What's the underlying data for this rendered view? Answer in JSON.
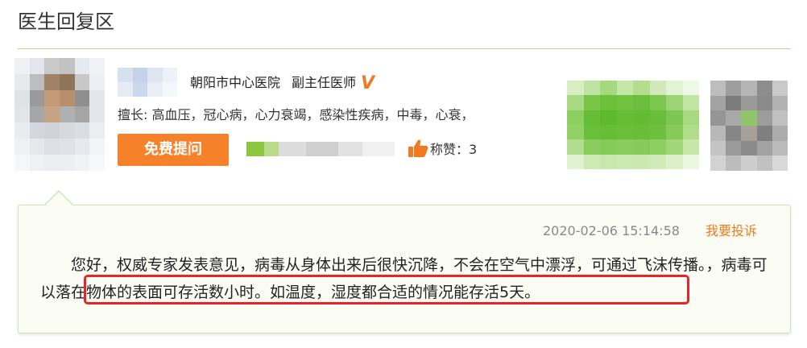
{
  "section": {
    "title": "医生回复区"
  },
  "doctor": {
    "hospital": "朝阳市中心医院",
    "title": "副主任医师",
    "verified_badge": "V",
    "specialty": "擅长: 高血压，冠心病，心力衰竭，感染性疾病，中毒，心衰，",
    "ask_button_label": "免费提问",
    "praise_label": "称赞：3"
  },
  "reply": {
    "timestamp": "2020-02-06 15:14:58",
    "complain_label": "我要投诉",
    "text_part1": "您好，权威专家发表意见，病毒从身体出来后很快沉降，不会在空气中漂浮，可通过飞沫传播。，",
    "text_highlight": "病毒可以落在物体的表面可存活数小时。如温度，湿度都合适的情况能存活5天。"
  },
  "icons": {
    "praise": "thumbs-up-icon",
    "verified": "verified-v-icon"
  },
  "colors": {
    "accent": "#f5822a",
    "divider": "#b8d8a0",
    "card_background": "#fbfdf5",
    "highlight_border": "#e5242b",
    "complain_link": "#f07a1f"
  }
}
